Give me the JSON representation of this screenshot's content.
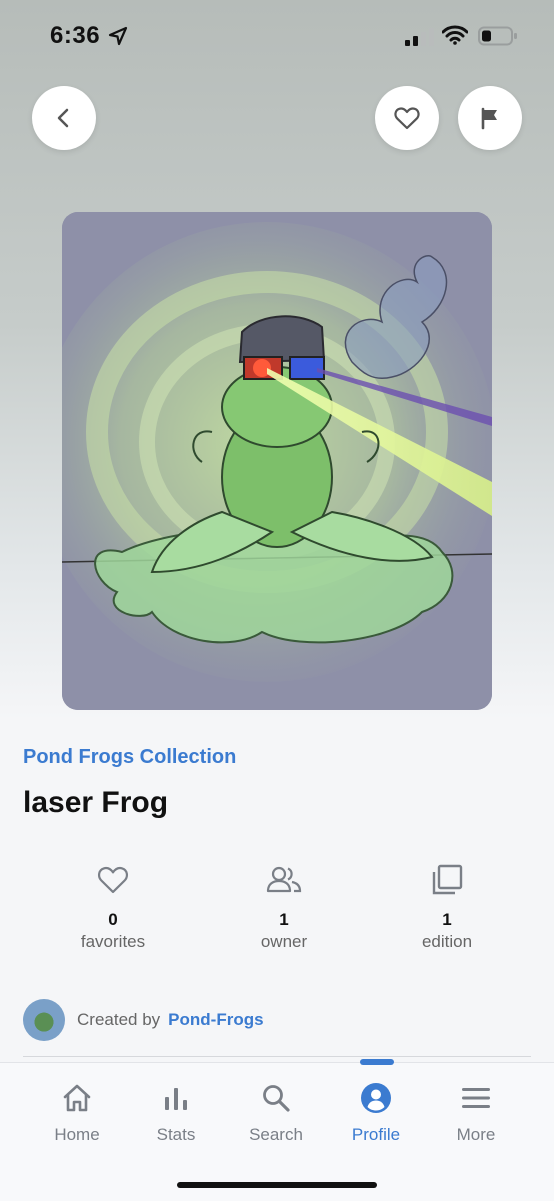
{
  "status": {
    "time": "6:36"
  },
  "item": {
    "collection": "Pond Frogs Collection",
    "title": "laser Frog"
  },
  "stats": [
    {
      "value": "0",
      "label": "favorites",
      "icon": "heart-outline-icon"
    },
    {
      "value": "1",
      "label": "owner",
      "icon": "people-icon"
    },
    {
      "value": "1",
      "label": "edition",
      "icon": "copies-icon"
    }
  ],
  "creator": {
    "prefix": "Created by",
    "name": "Pond-Frogs"
  },
  "tabs": [
    {
      "label": "Home",
      "icon": "home-icon",
      "active": false
    },
    {
      "label": "Stats",
      "icon": "bar-chart-icon",
      "active": false
    },
    {
      "label": "Search",
      "icon": "search-icon",
      "active": false
    },
    {
      "label": "Profile",
      "icon": "profile-icon",
      "active": true
    },
    {
      "label": "More",
      "icon": "menu-icon",
      "active": false
    }
  ],
  "colors": {
    "accent": "#3b7bd0",
    "text": "#111111",
    "muted": "#666666"
  }
}
